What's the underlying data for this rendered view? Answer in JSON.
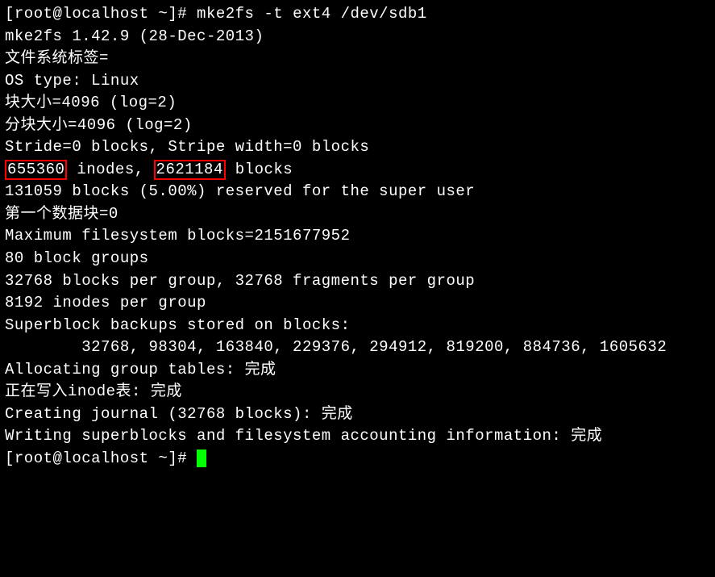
{
  "prompt1": "[root@localhost ~]# ",
  "command": "mke2fs -t ext4 /dev/sdb1",
  "version": "mke2fs 1.42.9 (28-Dec-2013)",
  "fs_label": "文件系统标签=",
  "os_type": "OS type: Linux",
  "block_size": "块大小=4096 (log=2)",
  "frag_size": "分块大小=4096 (log=2)",
  "stride": "Stride=0 blocks, Stripe width=0 blocks",
  "inodes_value": "655360",
  "inodes_label": " inodes, ",
  "blocks_value": "2621184",
  "blocks_label": " blocks",
  "reserved": "131059 blocks (5.00%) reserved for the super user",
  "first_data_block": "第一个数据块=0",
  "max_fs_blocks": "Maximum filesystem blocks=2151677952",
  "block_groups": "80 block groups",
  "blocks_per_group": "32768 blocks per group, 32768 fragments per group",
  "inodes_per_group": "8192 inodes per group",
  "superblock_header": "Superblock backups stored on blocks: ",
  "superblock_list": "        32768, 98304, 163840, 229376, 294912, 819200, 884736, 1605632",
  "empty": "",
  "alloc_group": "Allocating group tables: 完成",
  "writing_inode": "正在写入inode表: 完成",
  "creating_journal": "Creating journal (32768 blocks): 完成",
  "writing_superblocks": "Writing superblocks and filesystem accounting information: 完成",
  "prompt2": "[root@localhost ~]# "
}
